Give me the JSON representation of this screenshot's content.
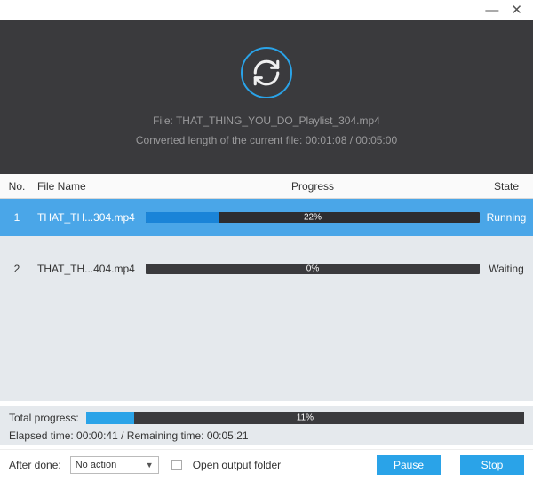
{
  "titlebar": {},
  "header": {
    "file_label": "File:",
    "file_name": "THAT_THING_YOU_DO_Playlist_304.mp4",
    "converted_prefix": "Converted length of the current file:",
    "current_time": "00:01:08",
    "total_time": "00:05:00"
  },
  "table": {
    "headers": {
      "no": "No.",
      "filename": "File Name",
      "progress": "Progress",
      "state": "State"
    },
    "rows": [
      {
        "no": "1",
        "filename": "THAT_TH...304.mp4",
        "progress_pct": 22,
        "progress_text": "22%",
        "state": "Running",
        "selected": true
      },
      {
        "no": "2",
        "filename": "THAT_TH...404.mp4",
        "progress_pct": 0,
        "progress_text": "0%",
        "state": "Waiting",
        "selected": false
      }
    ]
  },
  "total": {
    "label": "Total progress:",
    "pct": 11,
    "pct_text": "11%",
    "time_label": "Elapsed time:",
    "elapsed": "00:00:41",
    "remain_label": "/ Remaining time:",
    "remaining": "00:05:21"
  },
  "footer": {
    "after_done_label": "After done:",
    "dropdown_value": "No action",
    "open_folder_label": "Open output folder",
    "pause": "Pause",
    "stop": "Stop"
  }
}
